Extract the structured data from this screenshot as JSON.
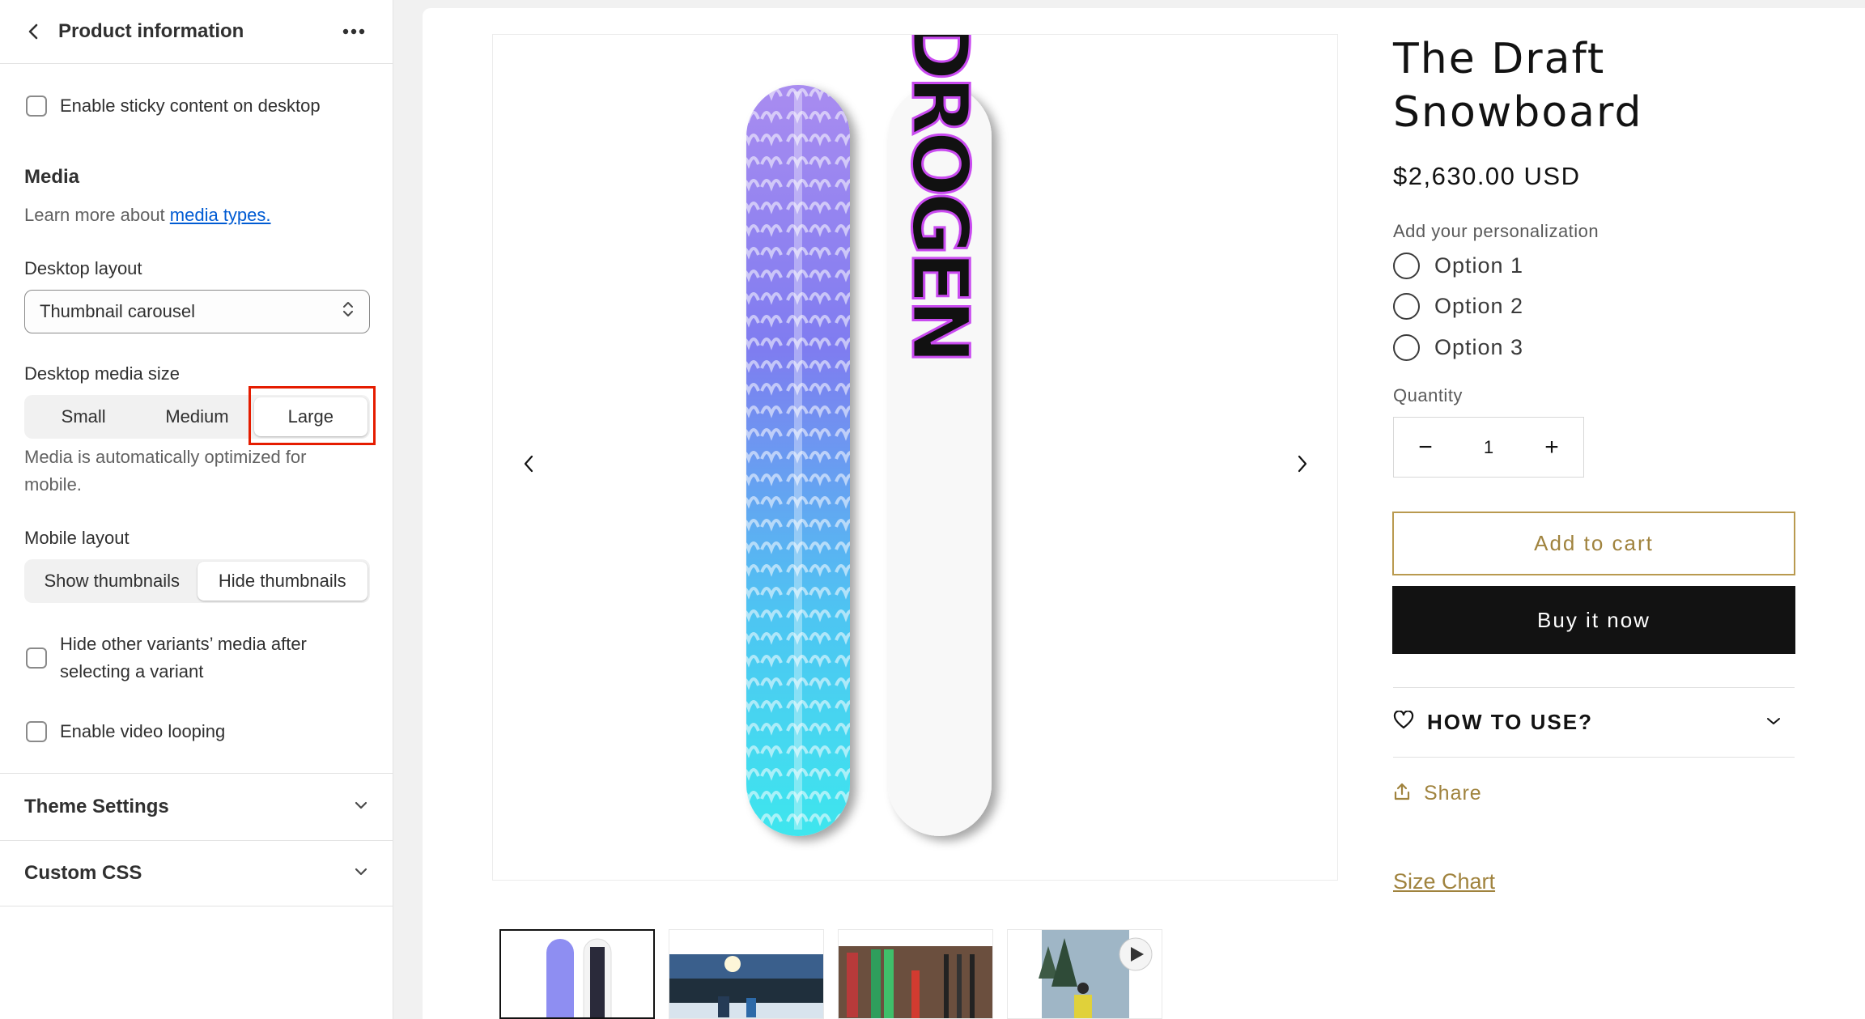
{
  "panel": {
    "title": "Product information",
    "sticky_label": "Enable sticky content on desktop",
    "media_heading": "Media",
    "media_help_prefix": "Learn more about ",
    "media_help_link": "media types.",
    "desktop_layout_label": "Desktop layout",
    "desktop_layout_value": "Thumbnail carousel",
    "media_size_label": "Desktop media size",
    "media_size_options": [
      "Small",
      "Medium",
      "Large"
    ],
    "media_size_selected": "Large",
    "media_size_help": "Media is automatically optimized for mobile.",
    "mobile_layout_label": "Mobile layout",
    "mobile_layout_options": [
      "Show thumbnails",
      "Hide thumbnails"
    ],
    "mobile_layout_selected": "Hide thumbnails",
    "hide_variants_label": "Hide other variants’ media after selecting a variant",
    "video_looping_label": "Enable video looping",
    "theme_settings": "Theme Settings",
    "custom_css": "Custom CSS"
  },
  "product": {
    "title_line1": "The Draft",
    "title_line2": "Snowboard",
    "price": "$2,630.00 USD",
    "personalization_label": "Add your personalization",
    "options": [
      "Option 1",
      "Option 2",
      "Option 3"
    ],
    "quantity_label": "Quantity",
    "quantity_value": "1",
    "minus": "−",
    "plus": "+",
    "add_to_cart": "Add to cart",
    "buy_now": "Buy it now",
    "how_to_use": "HOW TO USE?",
    "share": "Share",
    "size_chart": "Size Chart",
    "board_text": "HYDROGEN"
  },
  "colors": {
    "accent_gold": "#a0833e",
    "red_highlight": "#e51c00",
    "link_blue": "#005bd3",
    "dark_button": "#121212"
  },
  "icons": [
    "back-arrow-icon",
    "more-dots-icon",
    "select-chevrons-icon",
    "chevron-down-icon",
    "carousel-prev-icon",
    "carousel-next-icon",
    "heart-icon",
    "share-icon",
    "play-icon"
  ]
}
